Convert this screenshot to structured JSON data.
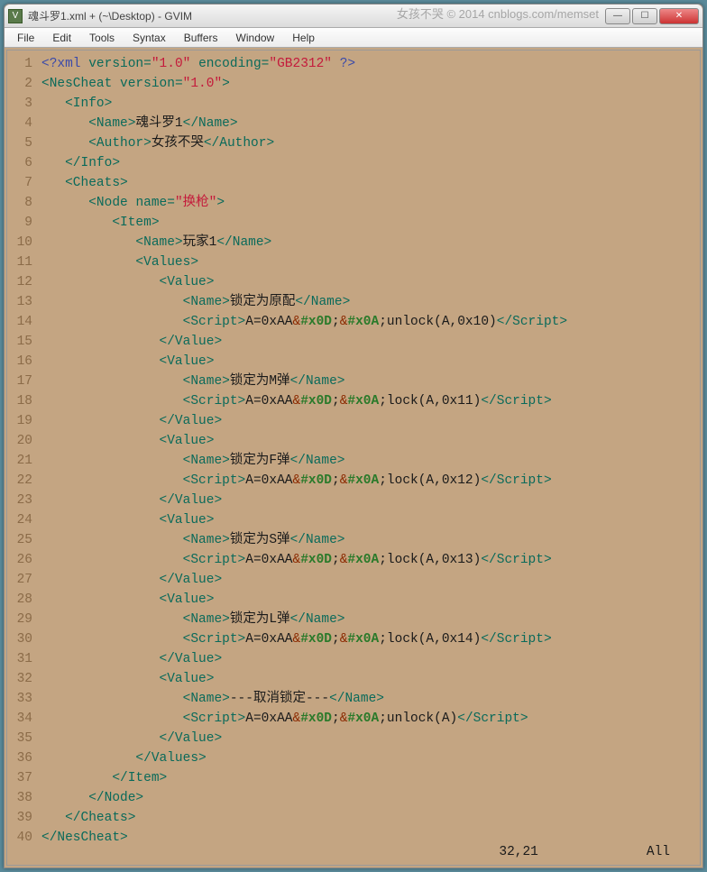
{
  "window": {
    "title": "魂斗罗1.xml + (~\\Desktop) - GVIM",
    "watermark": "女孩不哭 © 2014 cnblogs.com/memset"
  },
  "menu": {
    "file": "File",
    "edit": "Edit",
    "tools": "Tools",
    "syntax": "Syntax",
    "buffers": "Buffers",
    "window": "Window",
    "help": "Help"
  },
  "winbtns": {
    "min": "—",
    "max": "☐",
    "close": "✕"
  },
  "status": {
    "pos": "32,21",
    "pct": "All"
  },
  "code": {
    "xml_decl": "<?xml version=\"1.0\" encoding=\"GB2312\" ?>",
    "versions": {
      "xml": "1.0",
      "nescheat": "1.0",
      "encoding": "GB2312"
    },
    "info": {
      "name": "魂斗罗1",
      "author": "女孩不哭"
    },
    "node_name": "换枪",
    "item_name": "玩家1",
    "values": [
      {
        "name": "锁定为原配",
        "script": "A=0xAA&#x0D;&#x0A;unlock(A,0x10)"
      },
      {
        "name": "锁定为M弹",
        "script": "A=0xAA&#x0D;&#x0A;lock(A,0x11)"
      },
      {
        "name": "锁定为F弹",
        "script": "A=0xAA&#x0D;&#x0A;lock(A,0x12)"
      },
      {
        "name": "锁定为S弹",
        "script": "A=0xAA&#x0D;&#x0A;lock(A,0x13)"
      },
      {
        "name": "锁定为L弹",
        "script": "A=0xAA&#x0D;&#x0A;lock(A,0x14)"
      },
      {
        "name": "---取消锁定---",
        "script": "A=0xAA&#x0D;&#x0A;unlock(A)"
      }
    ],
    "scripts": {
      "prefix": "A=0xAA",
      "amp": "&",
      "cr": "#x0D",
      "lf": "#x0A",
      "sep": ";",
      "funcs": [
        "unlock(A,0x10)",
        "lock(A,0x11)",
        "lock(A,0x12)",
        "lock(A,0x13)",
        "lock(A,0x14)",
        "unlock(A)"
      ]
    }
  }
}
